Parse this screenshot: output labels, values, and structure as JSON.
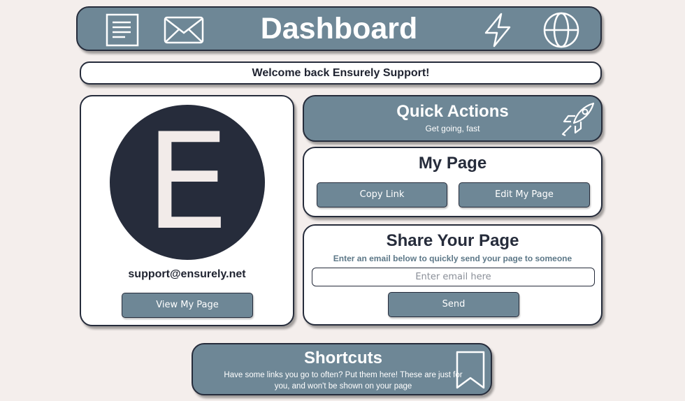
{
  "header": {
    "title": "Dashboard",
    "icons": [
      "document-icon",
      "mail-icon",
      "lightning-icon",
      "globe-icon"
    ]
  },
  "welcome": {
    "message": "Welcome back Ensurely Support!"
  },
  "profile": {
    "avatar_letter": "E",
    "email": "support@ensurely.net",
    "view_button_label": "View My Page"
  },
  "quick_actions": {
    "title": "Quick Actions",
    "subtitle": "Get going, fast",
    "icon": "rocket-icon"
  },
  "my_page": {
    "title": "My Page",
    "copy_link_label": "Copy Link",
    "edit_label": "Edit My Page"
  },
  "share": {
    "title": "Share Your Page",
    "subtitle": "Enter an email below to quickly send your page to someone",
    "email_placeholder": "Enter email here",
    "email_value": "",
    "send_label": "Send"
  },
  "shortcuts": {
    "title": "Shortcuts",
    "description": "Have some links you go to often? Put them here! These are just for you, and won't be shown on your page",
    "icon": "bookmark-icon"
  },
  "colors": {
    "background": "#f4eeec",
    "accent": "#6e8796",
    "dark": "#262c3b",
    "card": "#ffffff"
  }
}
